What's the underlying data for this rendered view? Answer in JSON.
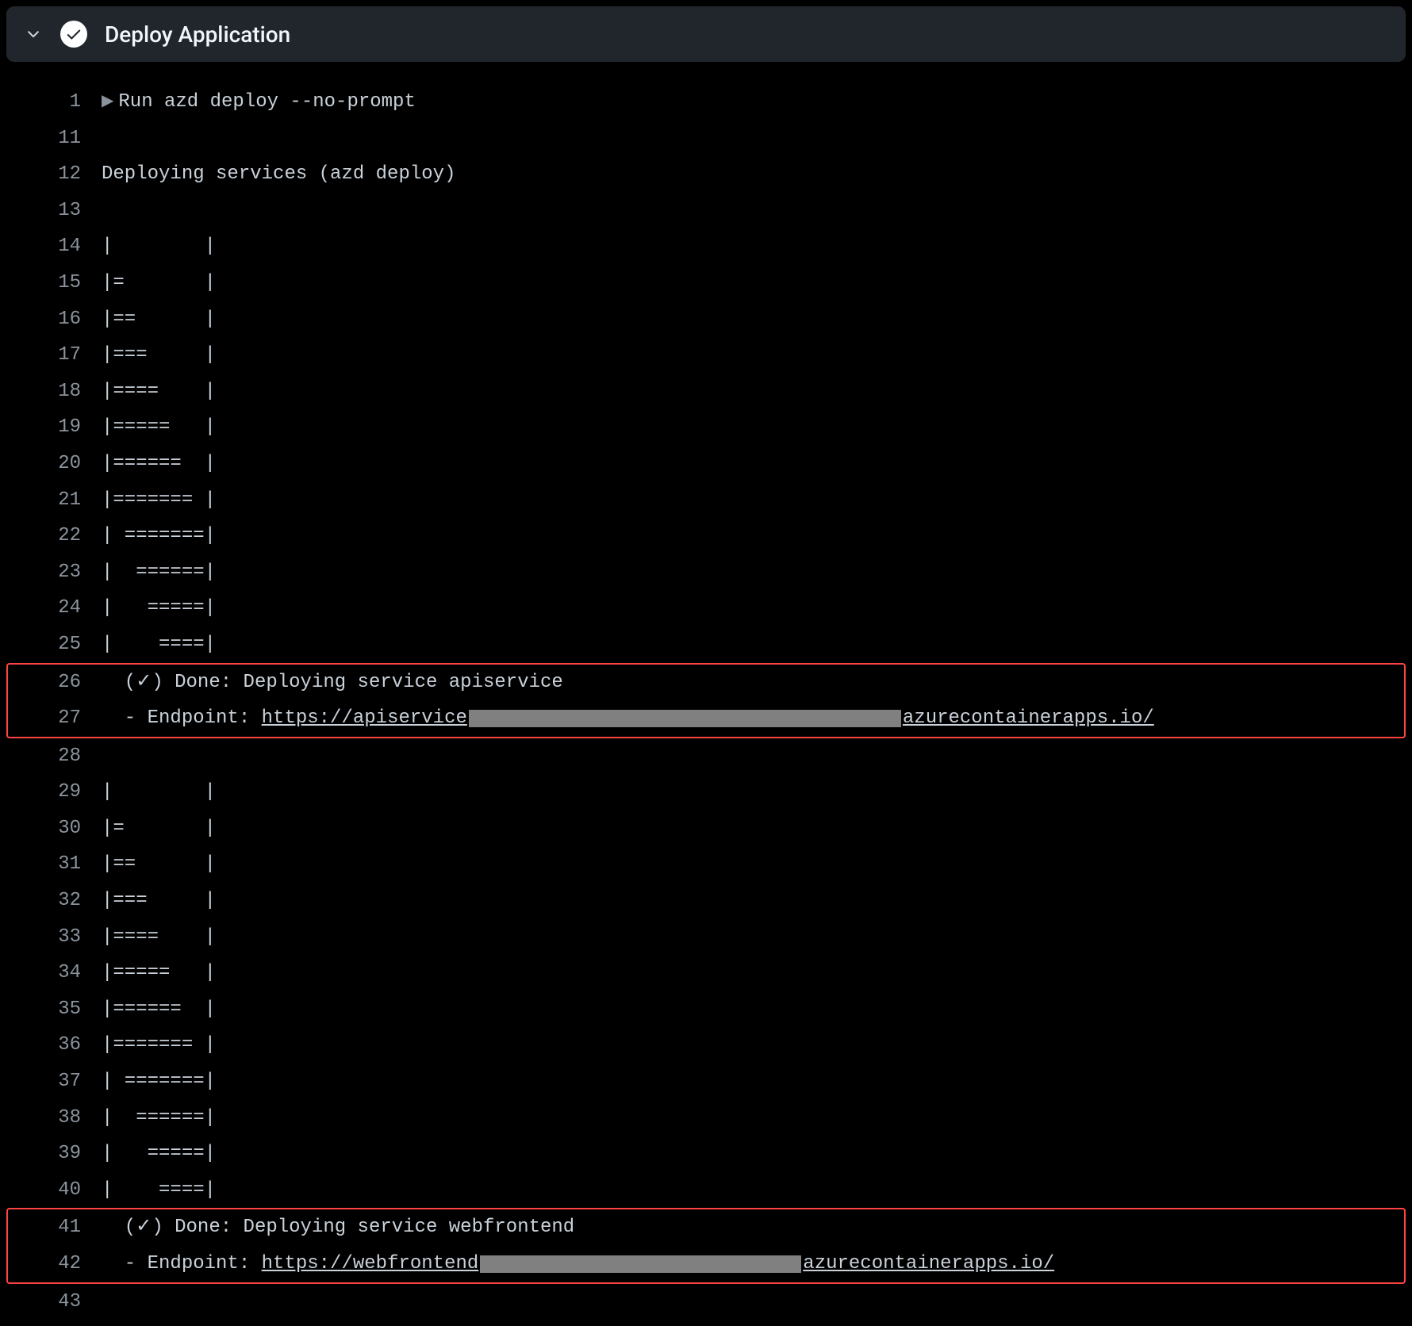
{
  "header": {
    "title": "Deploy Application"
  },
  "log": {
    "lines": [
      {
        "num": "1",
        "type": "run",
        "text": "Run azd deploy --no-prompt"
      },
      {
        "num": "11",
        "type": "plain",
        "text": ""
      },
      {
        "num": "12",
        "type": "plain",
        "text": "Deploying services (azd deploy)"
      },
      {
        "num": "13",
        "type": "plain",
        "text": ""
      },
      {
        "num": "14",
        "type": "plain",
        "text": "|        |"
      },
      {
        "num": "15",
        "type": "plain",
        "text": "|=       |"
      },
      {
        "num": "16",
        "type": "plain",
        "text": "|==      |"
      },
      {
        "num": "17",
        "type": "plain",
        "text": "|===     |"
      },
      {
        "num": "18",
        "type": "plain",
        "text": "|====    |"
      },
      {
        "num": "19",
        "type": "plain",
        "text": "|=====   |"
      },
      {
        "num": "20",
        "type": "plain",
        "text": "|======  |"
      },
      {
        "num": "21",
        "type": "plain",
        "text": "|======= |"
      },
      {
        "num": "22",
        "type": "plain",
        "text": "| =======|"
      },
      {
        "num": "23",
        "type": "plain",
        "text": "|  ======|"
      },
      {
        "num": "24",
        "type": "plain",
        "text": "|   =====|"
      },
      {
        "num": "25",
        "type": "plain",
        "text": "|    ====|"
      },
      {
        "num": "26",
        "type": "plain",
        "text": "  (✓) Done: Deploying service apiservice",
        "hl": "start"
      },
      {
        "num": "27",
        "type": "endpoint",
        "prefix": "  - Endpoint: ",
        "link_pre": "https://apiservice",
        "redact_width": 545,
        "link_post": "azurecontainerapps.io/",
        "hl": "end"
      },
      {
        "num": "28",
        "type": "plain",
        "text": ""
      },
      {
        "num": "29",
        "type": "plain",
        "text": "|        |"
      },
      {
        "num": "30",
        "type": "plain",
        "text": "|=       |"
      },
      {
        "num": "31",
        "type": "plain",
        "text": "|==      |"
      },
      {
        "num": "32",
        "type": "plain",
        "text": "|===     |"
      },
      {
        "num": "33",
        "type": "plain",
        "text": "|====    |"
      },
      {
        "num": "34",
        "type": "plain",
        "text": "|=====   |"
      },
      {
        "num": "35",
        "type": "plain",
        "text": "|======  |"
      },
      {
        "num": "36",
        "type": "plain",
        "text": "|======= |"
      },
      {
        "num": "37",
        "type": "plain",
        "text": "| =======|"
      },
      {
        "num": "38",
        "type": "plain",
        "text": "|  ======|"
      },
      {
        "num": "39",
        "type": "plain",
        "text": "|   =====|"
      },
      {
        "num": "40",
        "type": "plain",
        "text": "|    ====|"
      },
      {
        "num": "41",
        "type": "plain",
        "text": "  (✓) Done: Deploying service webfrontend",
        "hl": "start"
      },
      {
        "num": "42",
        "type": "endpoint",
        "prefix": "  - Endpoint: ",
        "link_pre": "https://webfrontend",
        "redact_width": 405,
        "link_post": "azurecontainerapps.io/",
        "hl": "end"
      },
      {
        "num": "43",
        "type": "plain",
        "text": ""
      }
    ]
  }
}
